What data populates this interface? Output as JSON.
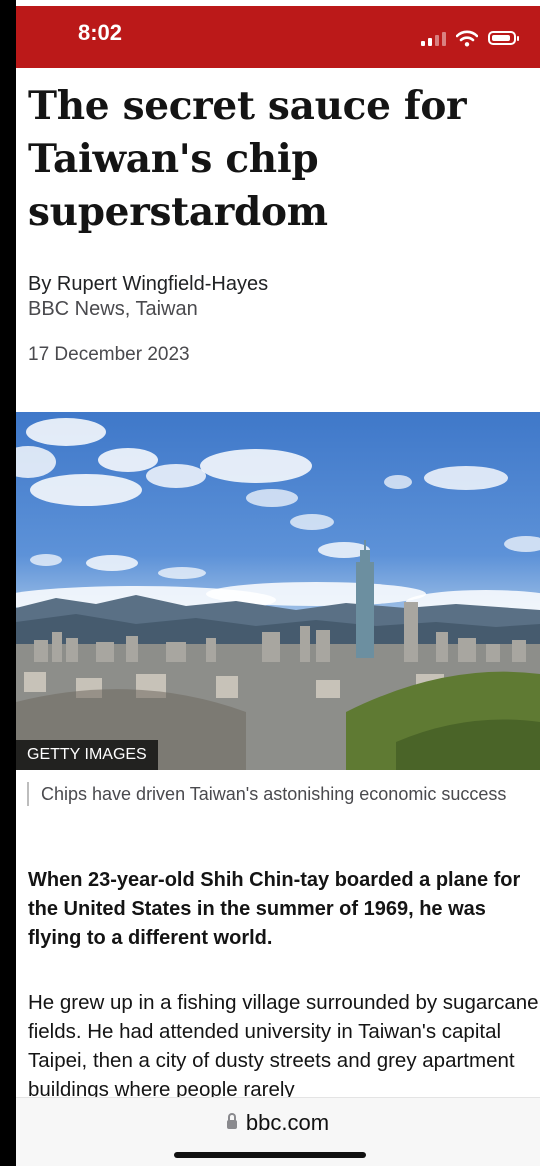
{
  "status_bar": {
    "time": "8:02"
  },
  "article": {
    "headline": "The secret sauce for Taiwan's chip superstardom",
    "author": "By Rupert Wingfield-Hayes",
    "outlet": "BBC News, Taiwan",
    "date": "17 December 2023",
    "image_credit": "GETTY IMAGES",
    "caption": "Chips have driven Taiwan's astonishing economic success",
    "lead": "When 23-year-old Shih Chin-tay boarded a plane for the United States in the summer of 1969, he was flying to a different world.",
    "body": "He grew up in a fishing village surrounded by sugarcane fields. He had attended university in Taiwan's capital Taipei, then a city of dusty streets and grey apartment buildings where people rarely"
  },
  "browser": {
    "url": "bbc.com"
  },
  "icons": [
    "signal-icon",
    "wifi-icon",
    "battery-icon",
    "lock-icon"
  ],
  "colors": {
    "accent": "#bb1919"
  }
}
